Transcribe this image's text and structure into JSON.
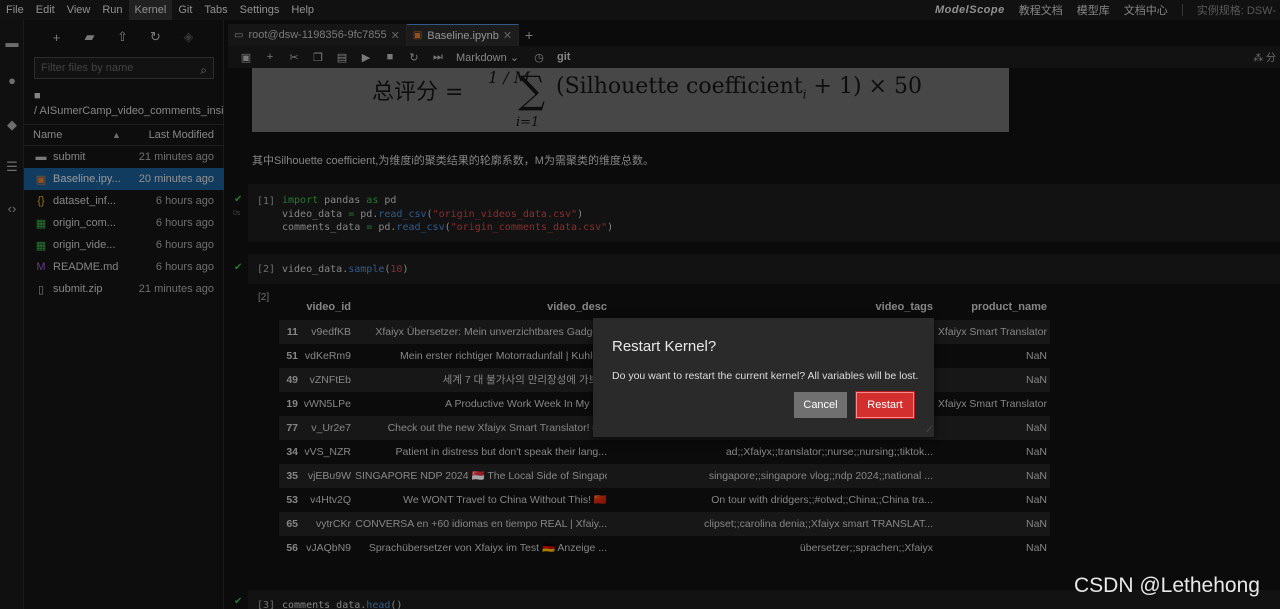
{
  "menubar": {
    "items": [
      "File",
      "Edit",
      "View",
      "Run",
      "Kernel",
      "Git",
      "Tabs",
      "Settings",
      "Help"
    ],
    "active_index": 4
  },
  "brand": {
    "logo": "ModelScope",
    "links": [
      "教程文档",
      "模型库",
      "文档中心"
    ],
    "spec": "实例规格: DSW-"
  },
  "filepanel": {
    "filter_placeholder": "Filter files by name",
    "crumb_root": "■",
    "crumb_path": "/ AISumerCamp_video_comments_insig",
    "col_name": "Name",
    "col_modified": "Last Modified",
    "files": [
      {
        "icon": "folder-icon",
        "glyph": "▬",
        "name": "submit",
        "modified": "21 minutes ago",
        "color": "#bbbbbb",
        "selected": false
      },
      {
        "icon": "notebook-icon",
        "glyph": "▣",
        "name": "Baseline.ipy...",
        "modified": "20 minutes ago",
        "color": "#e07a2a",
        "selected": true
      },
      {
        "icon": "json-icon",
        "glyph": "{}",
        "name": "dataset_inf...",
        "modified": "6 hours ago",
        "color": "#e0a82a",
        "selected": false
      },
      {
        "icon": "spreadsheet-icon",
        "glyph": "▦",
        "name": "origin_com...",
        "modified": "6 hours ago",
        "color": "#3bb54a",
        "selected": false
      },
      {
        "icon": "spreadsheet-icon",
        "glyph": "▦",
        "name": "origin_vide...",
        "modified": "6 hours ago",
        "color": "#3bb54a",
        "selected": false
      },
      {
        "icon": "markdown-icon",
        "glyph": "M",
        "name": "README.md",
        "modified": "6 hours ago",
        "color": "#9b59d0",
        "selected": false
      },
      {
        "icon": "file-icon",
        "glyph": "▯",
        "name": "submit.zip",
        "modified": "21 minutes ago",
        "color": "#bbbbbb",
        "selected": false
      }
    ]
  },
  "tabs": [
    {
      "label": "root@dsw-1198356-9fc7855",
      "icon": "terminal-icon",
      "active": false
    },
    {
      "label": "Baseline.ipynb",
      "icon": "notebook-icon",
      "active": true
    }
  ],
  "toolbar": {
    "cell_type": "Markdown",
    "git_label": "git",
    "right_label": "分"
  },
  "formula": {
    "lhs": "总评分 =",
    "fraction": "1 / M",
    "sigma": "∑",
    "sub": "i=1",
    "rhs": "(Silhouette coefficient",
    "rhs_sub": "i",
    "rhs_end": "+ 1) × 50"
  },
  "markdown_text": "其中Silhouette coefficient,为维度i的聚类结果的轮廓系数，M为需聚类的维度总数。",
  "cells": [
    {
      "prompt": "[1]",
      "lines": [
        "import pandas as pd",
        "video_data = pd.read_csv(\"origin_videos_data.csv\")",
        "comments_data = pd.read_csv(\"origin_comments_data.csv\")"
      ]
    },
    {
      "prompt": "[2]",
      "lines": [
        "video_data.sample(10)"
      ]
    },
    {
      "prompt": "[3]",
      "lines": [
        "comments_data.head()"
      ]
    }
  ],
  "output_prompt": "[2]",
  "table": {
    "headers": [
      "video_id",
      "video_desc",
      "video_tags",
      "product_name"
    ],
    "rows": [
      [
        "11",
        "v9edfKB",
        "Xfaiyx Übersetzer: Mein unverzichtbares Gadge...",
        "",
        "Xfaiyx Smart Translator"
      ],
      [
        "51",
        "vdKeRm9",
        "Mein erster richtiger Motorradunfall | Kuhle...",
        "",
        "NaN"
      ],
      [
        "49",
        "vZNFtEb",
        "세계 7 대 불가사의 만리장성에 가보...",
        "",
        "NaN"
      ],
      [
        "19",
        "vWN5LPe",
        "A Productive Work Week In My L...",
        "",
        "Xfaiyx Smart Translator"
      ],
      [
        "77",
        "v_Ur2e7",
        "Check out the new Xfaiyx Smart Translator! #...",
        "",
        "NaN"
      ],
      [
        "34",
        "vVS_NZR",
        "Patient in distress but don't speak their lang...",
        "ad;;Xfaiyx;;translator;;nurse;;nursing;;tiktok...",
        "NaN"
      ],
      [
        "35",
        "vjEBu9W",
        "SINGAPORE NDP 2024 🇸🇬 The Local Side of Singapore",
        "singapore;;singapore vlog;;ndp 2024;;national ...",
        "NaN"
      ],
      [
        "53",
        "v4Htv2Q",
        "We WONT Travel to China Without This! 🇨🇳",
        "On tour with dridgers;;#otwd;;China;;China tra...",
        "NaN"
      ],
      [
        "65",
        "vytrCKr",
        "CONVERSA en +60 idiomas en tiempo REAL | Xfaiy...",
        "clipset;;carolina denia;;Xfaiyx smart TRANSLAT...",
        "NaN"
      ],
      [
        "56",
        "vJAQbN9",
        "Sprachübersetzer von Xfaiyx im Test 🇩🇪 Anzeige ...",
        "übersetzer;;sprachen;;Xfaiyx",
        "NaN"
      ]
    ]
  },
  "dialog": {
    "title": "Restart Kernel?",
    "body": "Do you want to restart the current kernel? All variables will be lost.",
    "cancel": "Cancel",
    "restart": "Restart"
  },
  "watermark": "CSDN @Lethehong"
}
